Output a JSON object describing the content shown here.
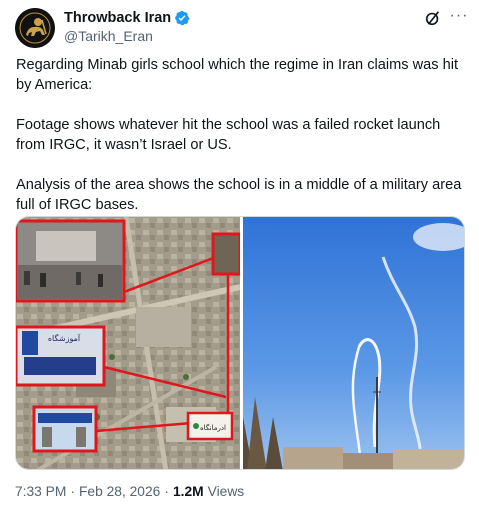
{
  "author": {
    "display_name": "Throwback Iran",
    "handle": "@Tarikh_Eran"
  },
  "post": {
    "paragraphs": [
      "Regarding Minab girls school which the regime in Iran claims was hit by America:",
      "Footage shows whatever hit the school was a failed rocket launch from IRGC, it wasn’t Israel or US.",
      "Analysis of the area shows the school is in a middle of a military area full of IRGC bases."
    ]
  },
  "media": {
    "left_image": "satellite map with annotated school photos",
    "left_sign_text_top": "ادرمانگاه",
    "left_sign_text_bottom": "آموزشگاه",
    "right_image": "sky with rocket smoke trail"
  },
  "meta": {
    "time": "7:33 PM",
    "date": "Feb 28, 2026",
    "views_count": "1.2M",
    "views_label": "Views"
  },
  "colors": {
    "text": "#0f1419",
    "secondary": "#536471",
    "verified": "#1d9bf0",
    "annotation": "#e0161c"
  },
  "icons": {
    "verified": "verified-badge-icon",
    "grok": "grok-icon",
    "more": "more-icon"
  }
}
